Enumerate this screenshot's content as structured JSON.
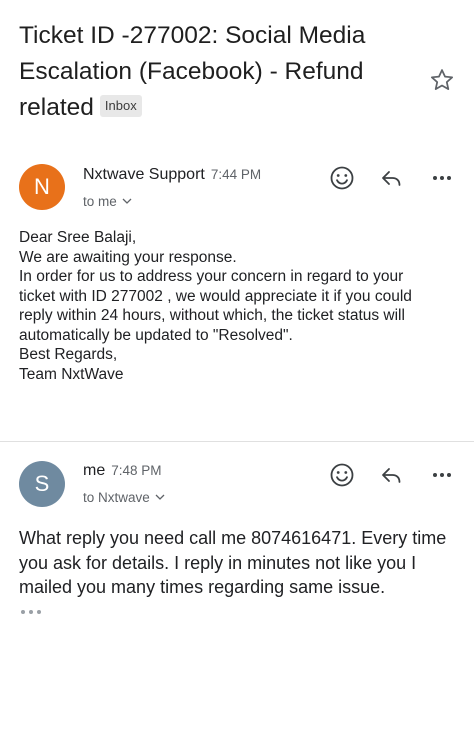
{
  "email": {
    "subject": "Ticket ID -277002: Social Media Escalation (Facebook) - Refund related",
    "label_badge": "Inbox"
  },
  "messages": [
    {
      "avatar_letter": "N",
      "avatar_color": "#e8711a",
      "sender": "Nxtwave Support",
      "time": "7:44 PM",
      "recipient": "to me",
      "body_lines": [
        "Dear Sree Balaji,",
        "We are awaiting your response.",
        "In order for us to address your concern in regard to your",
        "ticket with ID 277002 , we would appreciate it if you could",
        "reply within 24 hours, without which, the ticket status will",
        "automatically be updated to \"Resolved\".",
        "Best Regards,",
        "Team NxtWave"
      ]
    },
    {
      "avatar_letter": "S",
      "avatar_color": "#6f8aa0",
      "sender": "me",
      "time": "7:48 PM",
      "recipient": "to Nxtwave",
      "body": "What reply you need call me 8074616471. Every time you ask for details. I reply in minutes not like you I mailed you many times regarding same issue."
    }
  ],
  "icons": {
    "star": "star-outline-icon",
    "emoji": "smiley-icon",
    "reply": "reply-arrow-icon",
    "more": "more-horizontal-icon",
    "expand": "chevron-down-icon",
    "trimmed": "ellipsis-icon"
  }
}
